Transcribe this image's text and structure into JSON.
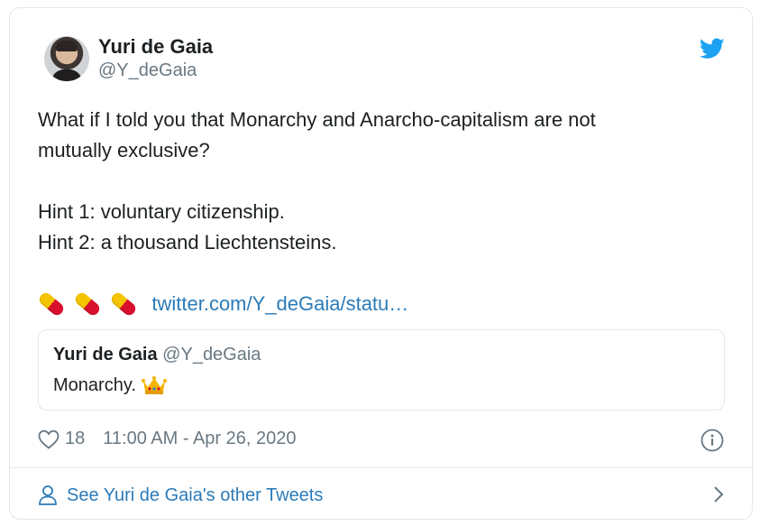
{
  "tweet": {
    "author_name": "Yuri de Gaia",
    "author_handle": "@Y_deGaia",
    "text_lines": [
      "What if I told you that Monarchy and Anarcho-capitalism are not",
      "mutually exclusive?",
      "",
      "Hint 1: voluntary citizenship.",
      "Hint 2: a thousand Liechtensteins."
    ],
    "pill_emoji_count": 3,
    "link_text": "twitter.com/Y_deGaia/statu…",
    "quoted": {
      "author_name": "Yuri de Gaia",
      "author_handle": "@Y_deGaia",
      "text": "Monarchy."
    },
    "like_count": "18",
    "timestamp": "11:00 AM - Apr 26, 2020",
    "footer_link": "See Yuri de Gaia's other Tweets"
  },
  "icons": {
    "brand": "twitter-bird-icon",
    "like": "heart-icon",
    "info": "info-icon",
    "person": "person-icon",
    "chevron": "chevron-right-icon",
    "crown": "crown-emoji-icon",
    "pill": "pill-emoji-icon"
  },
  "colors": {
    "twitter_blue": "#1da1f2",
    "link_blue": "#2b7bb9",
    "text": "#1c2022",
    "muted": "#697882",
    "border": "#e1e8ed"
  }
}
